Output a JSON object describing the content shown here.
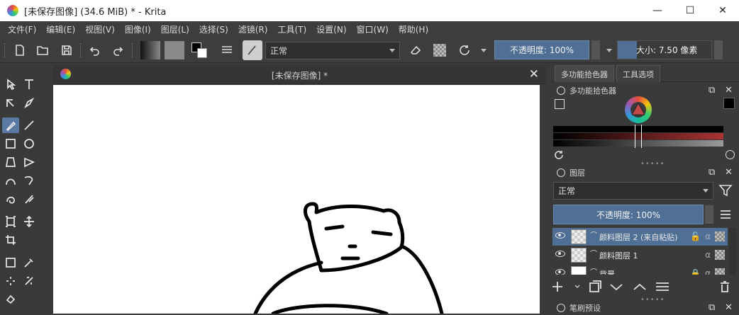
{
  "window": {
    "title": "[未保存图像]  (34.6 MiB)  * - Krita",
    "minimize": "—",
    "maximize": "☐",
    "close": "✕"
  },
  "menu": [
    "文件(F)",
    "编辑(E)",
    "视图(V)",
    "图像(I)",
    "图层(L)",
    "选择(S)",
    "滤镜(R)",
    "工具(T)",
    "设置(N)",
    "窗口(W)",
    "帮助(H)"
  ],
  "toolbar": {
    "blend_mode": "正常",
    "opacity_label": "不透明度: 100%",
    "size_label": "大小: 7.50 像素",
    "opacity_value": 1.0
  },
  "canvas": {
    "tab_title": "[未保存图像]  *",
    "close": "✕"
  },
  "docker": {
    "tabs": [
      "多功能拾色器",
      "工具选项"
    ],
    "color_panel_title": "多功能拾色器",
    "layers_panel_title": "图层",
    "blend_mode": "正常",
    "opacity_label": "不透明度:  100%",
    "layers": [
      {
        "name": "颜料图层 2 (来自粘贴)",
        "selected": true
      },
      {
        "name": "颜料图层 1",
        "selected": false
      },
      {
        "name": "背景",
        "selected": false
      }
    ],
    "brush_panel_title": "笔刷预设"
  },
  "colors": {
    "accent": "#4f6f95",
    "panel": "#3a3a3a",
    "canvas": "#ffffff"
  }
}
